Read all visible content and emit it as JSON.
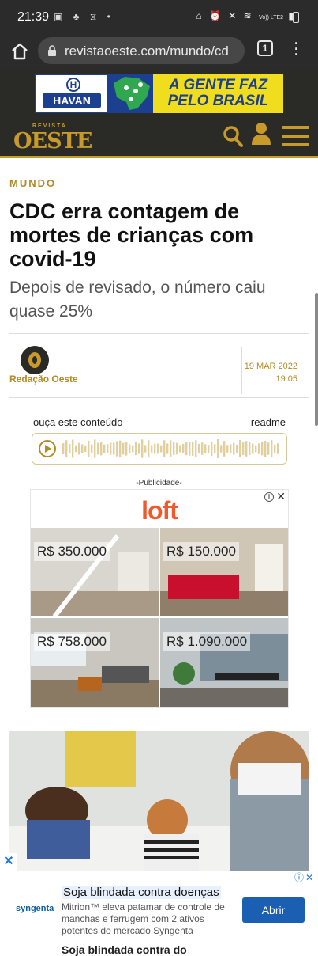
{
  "status_bar": {
    "time": "21:39",
    "network": "Vo)) LTE2"
  },
  "browser": {
    "url": "revistaoeste.com/mundo/cd",
    "tab_count": "1"
  },
  "header_ad": {
    "brand": "HAVAN",
    "slogan_line1": "A GENTE FAZ",
    "slogan_line2": "PELO BRASIL"
  },
  "site": {
    "logo_small": "REVISTA",
    "logo_big": "OESTE",
    "accent": "#c79a2b"
  },
  "article": {
    "section": "MUNDO",
    "title": "CDC erra contagem de mortes de crianças com covid-19",
    "subtitle": "Depois de revisado, o número caiu quase 25%",
    "author": "Redação Oeste",
    "date": "19 MAR 2022",
    "time": "19:05"
  },
  "audio": {
    "label": "ouça este conteúdo",
    "brand": "readme"
  },
  "ad": {
    "label": "-Publicidade-",
    "brand": "loft",
    "prices": [
      "R$ 350.000",
      "R$ 150.000",
      "R$ 758.000",
      "R$ 1.090.000"
    ]
  },
  "bottom_ad": {
    "advertiser": "syngenta",
    "title": "Soja blindada contra doenças",
    "text": "Mitrion™ eleva patamar de controle de manchas e ferrugem com 2 ativos potentes do mercado Syngenta",
    "cta": "Abrir",
    "peek": "Soja blindada contra do"
  }
}
